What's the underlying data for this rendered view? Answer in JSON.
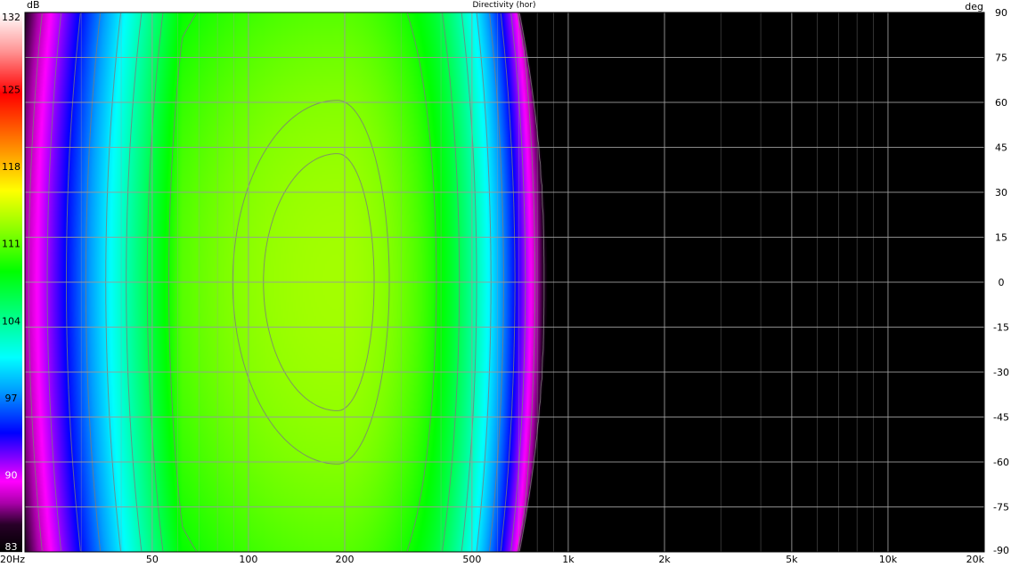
{
  "chart_data": {
    "type": "heatmap",
    "title": "Directivity (hor)",
    "x_scale": "log",
    "x_range": [
      20,
      20000
    ],
    "x_ticks": [
      {
        "value": 20,
        "label": "20Hz"
      },
      {
        "value": 50,
        "label": "50"
      },
      {
        "value": 100,
        "label": "100"
      },
      {
        "value": 200,
        "label": "200"
      },
      {
        "value": 500,
        "label": "500"
      },
      {
        "value": 1000,
        "label": "1k"
      },
      {
        "value": 2000,
        "label": "2k"
      },
      {
        "value": 5000,
        "label": "5k"
      },
      {
        "value": 10000,
        "label": "10k"
      },
      {
        "value": 20000,
        "label": "20k"
      }
    ],
    "y_unit_label": "deg",
    "y_range": [
      -90,
      90
    ],
    "y_ticks": [
      "90",
      "75",
      "60",
      "45",
      "30",
      "15",
      "0",
      "-15",
      "-30",
      "-45",
      "-60",
      "-75",
      "-90"
    ],
    "colorbar": {
      "unit_label": "dB",
      "range": [
        83,
        132
      ],
      "ticks": [
        "132",
        "125",
        "118",
        "111",
        "104",
        "97",
        "90",
        "83"
      ]
    },
    "field": {
      "peak_db": 113,
      "peak_frequency_hz": 190,
      "peak_angle_deg": 0,
      "low_rolloff_frequency_hz": 62,
      "high_rolloff_frequency_hz": 330,
      "cutoff_frequency_hz_on_axis": 850,
      "cutoff_frequency_hz_at_90_deg": 690
    },
    "grid": true,
    "colors": {
      "background": "#000000",
      "grid": "#9a9a9a",
      "contour": "#7a7a7a"
    }
  }
}
